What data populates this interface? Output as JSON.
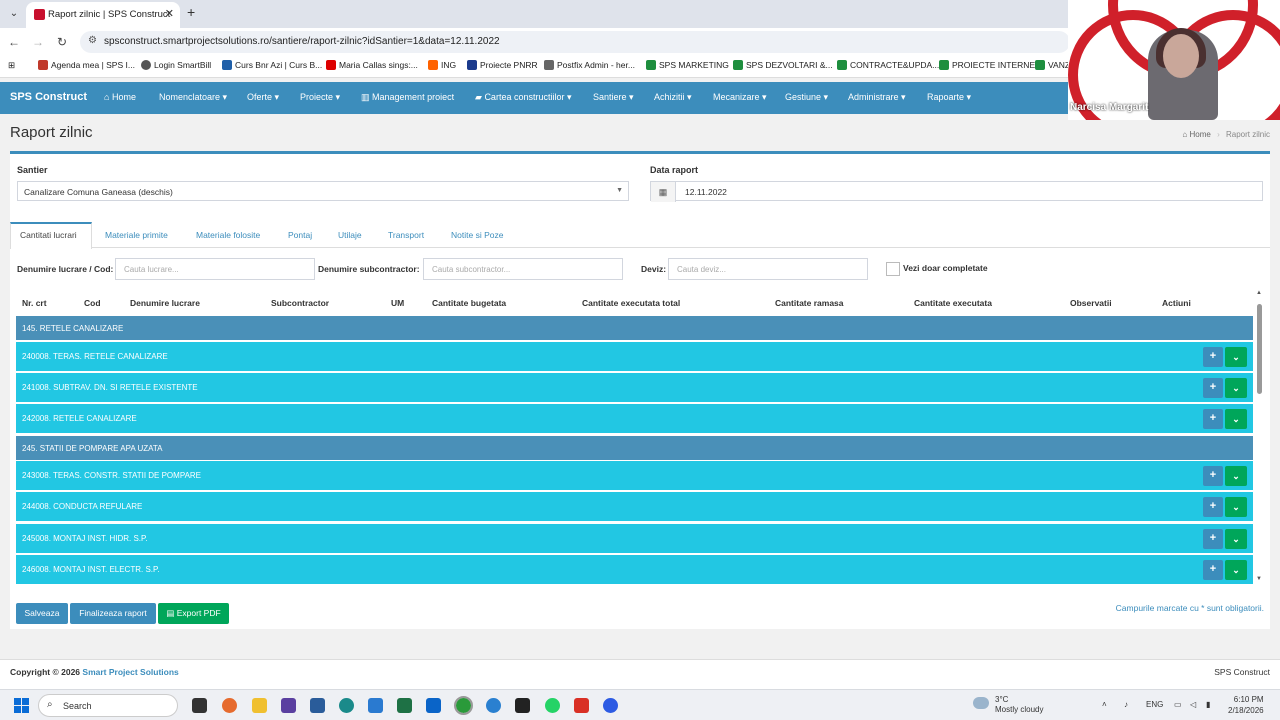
{
  "browser": {
    "tab_title": "Raport zilnic | SPS Construct",
    "url": "spsconstruct.smartprojectsolutions.ro/santiere/raport-zilnic?idSantier=1&data=12.11.2022",
    "bookmarks": [
      "Agenda mea | SPS I...",
      "Login SmartBill",
      "Curs Bnr Azi | Curs B...",
      "Maria Callas sings:...",
      "ING",
      "Proiecte PNRR",
      "Postfix Admin - her...",
      "SPS MARKETING",
      "SPS DEZVOLTARI &...",
      "CONTRACTE&UPDA...",
      "PROIECTE INTERNE",
      "VANZ"
    ]
  },
  "video": {
    "participant": "Narcisa Margarit"
  },
  "navbar": {
    "brand": "SPS Construct",
    "items": [
      "Home",
      "Nomenclatoare ▾",
      "Oferte ▾",
      "Proiecte ▾",
      "Management proiect",
      "Cartea constructiilor ▾",
      "Santiere ▾",
      "Achizitii ▾",
      "Mecanizare ▾",
      "Gestiune ▾",
      "Administrare ▾",
      "Rapoarte ▾"
    ]
  },
  "page": {
    "title": "Raport zilnic",
    "breadcrumb_home": "Home",
    "breadcrumb_current": "Raport zilnic"
  },
  "form": {
    "santier_label": "Santier",
    "santier_value": "Canalizare Comuna Ganeasa (deschis)",
    "data_label": "Data raport",
    "data_value": "12.11.2022"
  },
  "tabs": [
    "Cantitati lucrari",
    "Materiale primite",
    "Materiale folosite",
    "Pontaj",
    "Utilaje",
    "Transport",
    "Notite si Poze"
  ],
  "filters": {
    "lucrare_label": "Denumire lucrare / Cod:",
    "lucrare_placeholder": "Cauta lucrare...",
    "subcontractor_label": "Denumire subcontractor:",
    "subcontractor_placeholder": "Cauta subcontractor...",
    "deviz_label": "Deviz:",
    "deviz_placeholder": "Cauta deviz...",
    "completed_label": "Vezi doar completate"
  },
  "table": {
    "headers": [
      "Nr. crt",
      "Cod",
      "Denumire lucrare",
      "Subcontractor",
      "UM",
      "Cantitate bugetata",
      "Cantitate executata total",
      "Cantitate ramasa",
      "Cantitate executata",
      "Observatii",
      "Actiuni"
    ],
    "groups": [
      {
        "name": "145. RETELE CANALIZARE",
        "rows": [
          "240008. TERAS. RETELE CANALIZARE",
          "241008. SUBTRAV. DN. SI RETELE EXISTENTE",
          "242008. RETELE CANALIZARE"
        ]
      },
      {
        "name": "245. STATII DE POMPARE APA UZATA",
        "rows": [
          "243008. TERAS. CONSTR. STATII DE POMPARE",
          "244008. CONDUCTA REFULARE",
          "245008. MONTAJ INST. HIDR. S.P.",
          "246008. MONTAJ INST. ELECTR. S.P."
        ]
      }
    ],
    "plus_glyph": "+",
    "dropdown_glyph": "⌄"
  },
  "actions": {
    "save": "Salveaza",
    "finalize": "Finalizeaza raport",
    "export": "Export PDF",
    "required_note": "Campurile marcate cu * sunt obligatorii."
  },
  "footer": {
    "copyright": "Copyright © 2026",
    "company": "Smart Project Solutions",
    "right": "SPS Construct"
  },
  "taskbar": {
    "search": "Search",
    "weather_temp": "3°C",
    "weather_desc": "Mostly cloudy",
    "lang": "ENG",
    "time": "6:10 PM",
    "date": "2/18/2026"
  },
  "colors": {
    "primary": "#3c8dbc",
    "group_row": "#4a90b8",
    "item_row": "#22c7e3",
    "success": "#00a65a"
  }
}
